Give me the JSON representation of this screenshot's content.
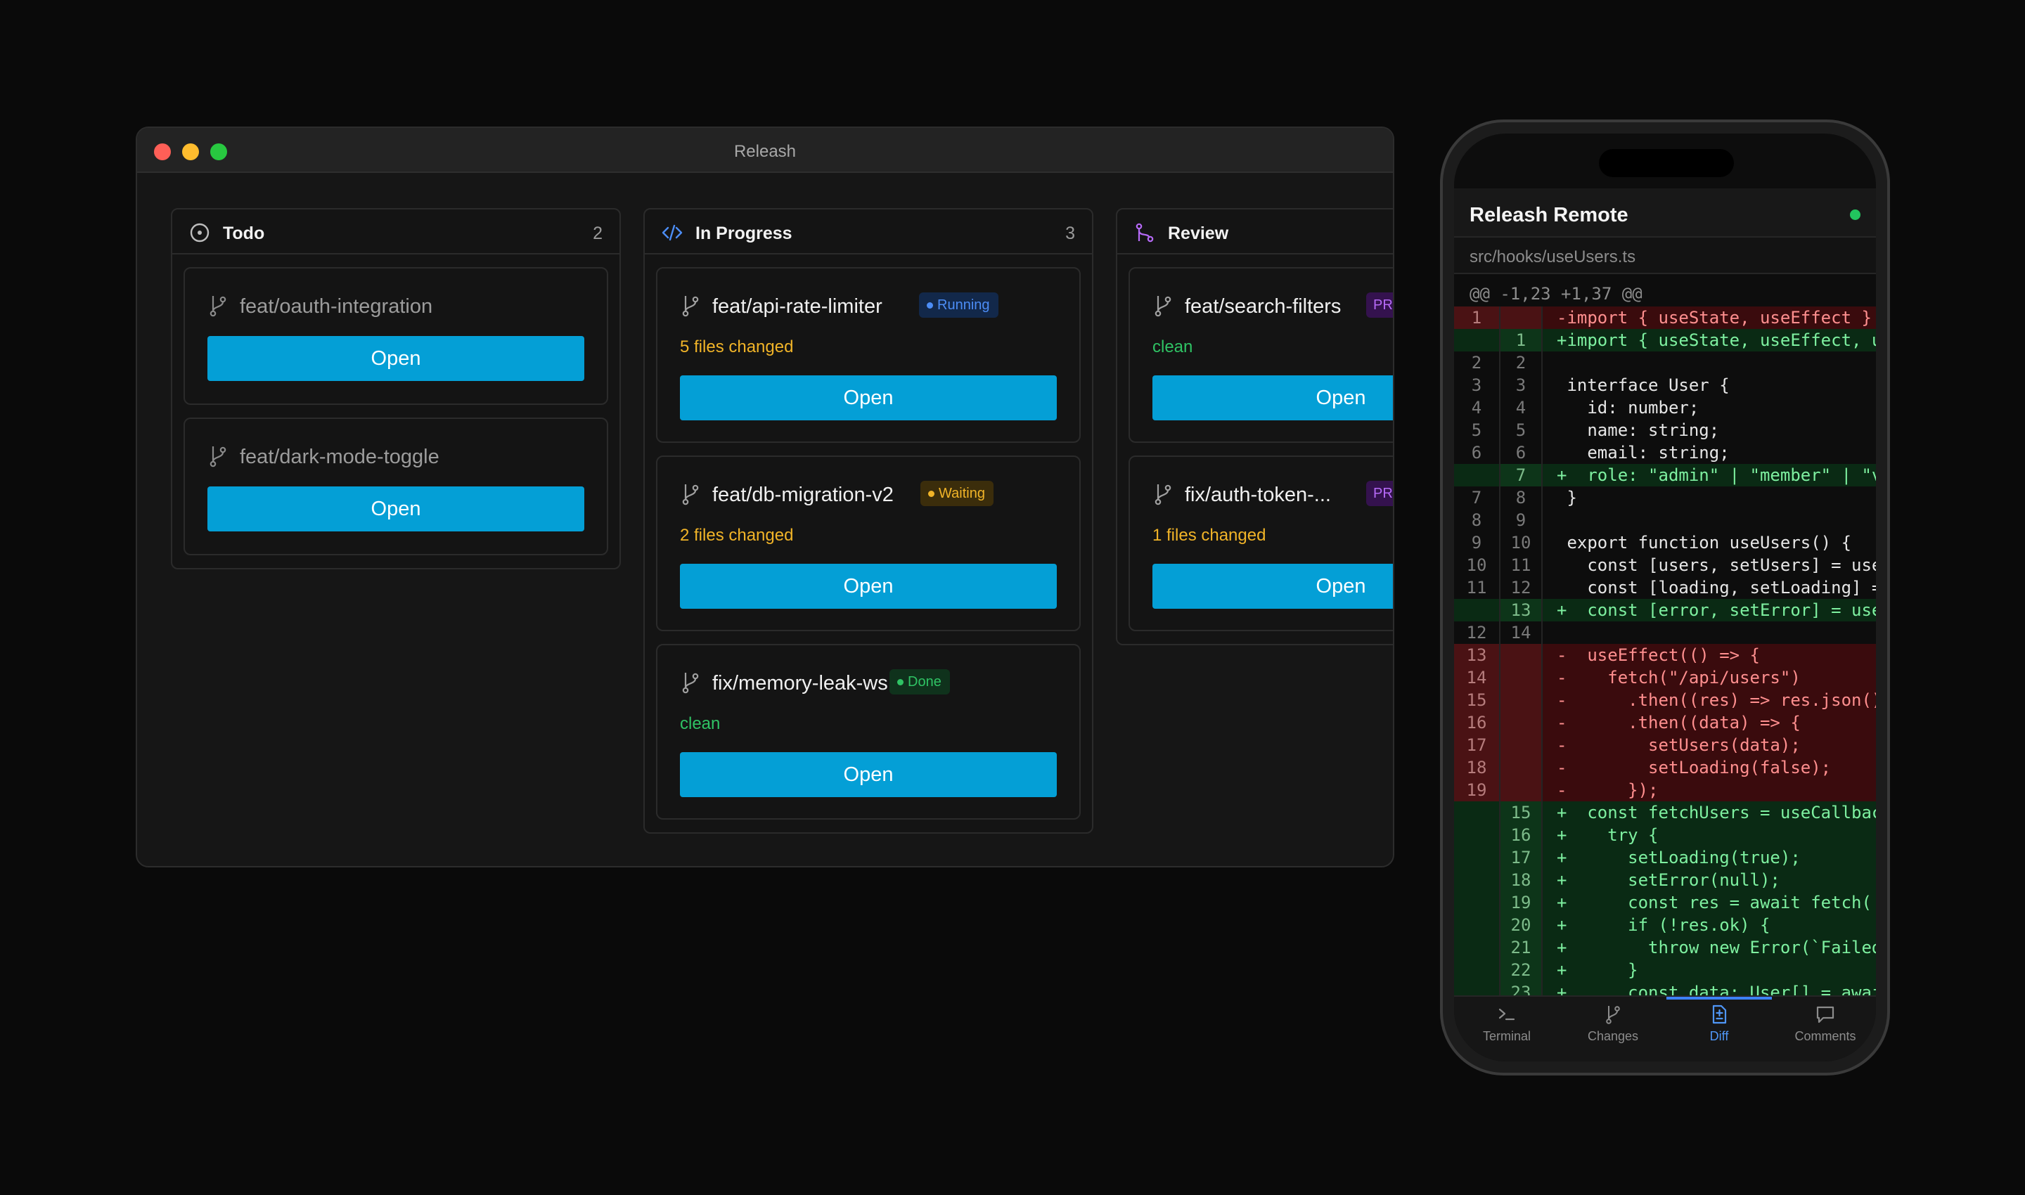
{
  "window": {
    "title": "Releash",
    "columns": [
      {
        "title": "Todo",
        "count": "2",
        "icon": "circle-dot-icon",
        "cards": [
          {
            "branch": "feat/oauth-integration",
            "button": "Open"
          },
          {
            "branch": "feat/dark-mode-toggle",
            "button": "Open"
          }
        ]
      },
      {
        "title": "In Progress",
        "count": "3",
        "icon": "code-icon",
        "cards": [
          {
            "branch": "feat/api-rate-limiter",
            "badge": "Running",
            "status": "5 files changed",
            "button": "Open"
          },
          {
            "branch": "feat/db-migration-v2",
            "badge": "Waiting",
            "status": "2 files changed",
            "button": "Open"
          },
          {
            "branch": "fix/memory-leak-ws",
            "badge": "Done",
            "status": "clean",
            "button": "Open"
          }
        ]
      },
      {
        "title": "Review",
        "icon": "git-pull-request-icon",
        "cards": [
          {
            "branch": "feat/search-filters",
            "badge": "PR",
            "status": "clean",
            "button": "Open"
          },
          {
            "branch": "fix/auth-token-...",
            "badge": "PR",
            "status": "1 files changed",
            "button": "Open"
          }
        ]
      }
    ]
  },
  "colors": {
    "accent_button": "#049fd6",
    "running": "#4c8df5",
    "waiting": "#f1b428",
    "done": "#2fc364",
    "pr": "#b66af7"
  },
  "phone": {
    "title": "Releash Remote",
    "file_path": "src/hooks/useUsers.ts",
    "hunk_header": "@@ -1,23 +1,37 @@",
    "diff_lines": [
      {
        "type": "del",
        "old": "1",
        "new": "",
        "text": "-import { useState, useEffect }"
      },
      {
        "type": "add",
        "old": "",
        "new": "1",
        "text": "+import { useState, useEffect, u"
      },
      {
        "type": "ctx",
        "old": "2",
        "new": "2",
        "text": ""
      },
      {
        "type": "ctx",
        "old": "3",
        "new": "3",
        "text": " interface User {"
      },
      {
        "type": "ctx",
        "old": "4",
        "new": "4",
        "text": "   id: number;"
      },
      {
        "type": "ctx",
        "old": "5",
        "new": "5",
        "text": "   name: string;"
      },
      {
        "type": "ctx",
        "old": "6",
        "new": "6",
        "text": "   email: string;"
      },
      {
        "type": "add",
        "old": "",
        "new": "7",
        "text": "+  role: \"admin\" | \"member\" | \"v"
      },
      {
        "type": "ctx",
        "old": "7",
        "new": "8",
        "text": " }"
      },
      {
        "type": "ctx",
        "old": "8",
        "new": "9",
        "text": ""
      },
      {
        "type": "ctx",
        "old": "9",
        "new": "10",
        "text": " export function useUsers() {"
      },
      {
        "type": "ctx",
        "old": "10",
        "new": "11",
        "text": "   const [users, setUsers] = use"
      },
      {
        "type": "ctx",
        "old": "11",
        "new": "12",
        "text": "   const [loading, setLoading] ="
      },
      {
        "type": "add",
        "old": "",
        "new": "13",
        "text": "+  const [error, setError] = use"
      },
      {
        "type": "ctx",
        "old": "12",
        "new": "14",
        "text": ""
      },
      {
        "type": "del",
        "old": "13",
        "new": "",
        "text": "-  useEffect(() => {"
      },
      {
        "type": "del",
        "old": "14",
        "new": "",
        "text": "-    fetch(\"/api/users\")"
      },
      {
        "type": "del",
        "old": "15",
        "new": "",
        "text": "-      .then((res) => res.json()"
      },
      {
        "type": "del",
        "old": "16",
        "new": "",
        "text": "-      .then((data) => {"
      },
      {
        "type": "del",
        "old": "17",
        "new": "",
        "text": "-        setUsers(data);"
      },
      {
        "type": "del",
        "old": "18",
        "new": "",
        "text": "-        setLoading(false);"
      },
      {
        "type": "del",
        "old": "19",
        "new": "",
        "text": "-      });"
      },
      {
        "type": "add",
        "old": "",
        "new": "15",
        "text": "+  const fetchUsers = useCallbac"
      },
      {
        "type": "add",
        "old": "",
        "new": "16",
        "text": "+    try {"
      },
      {
        "type": "add",
        "old": "",
        "new": "17",
        "text": "+      setLoading(true);"
      },
      {
        "type": "add",
        "old": "",
        "new": "18",
        "text": "+      setError(null);"
      },
      {
        "type": "add",
        "old": "",
        "new": "19",
        "text": "+      const res = await fetch('"
      },
      {
        "type": "add",
        "old": "",
        "new": "20",
        "text": "+      if (!res.ok) {"
      },
      {
        "type": "add",
        "old": "",
        "new": "21",
        "text": "+        throw new Error(`Failed"
      },
      {
        "type": "add",
        "old": "",
        "new": "22",
        "text": "+      }"
      },
      {
        "type": "add",
        "old": "",
        "new": "23",
        "text": "+      const data: User[] = awai"
      }
    ],
    "tabs": [
      {
        "label": "Terminal",
        "icon": "terminal-icon"
      },
      {
        "label": "Changes",
        "icon": "git-branch-icon"
      },
      {
        "label": "Diff",
        "icon": "file-diff-icon",
        "active": true
      },
      {
        "label": "Comments",
        "icon": "comment-icon"
      }
    ]
  }
}
